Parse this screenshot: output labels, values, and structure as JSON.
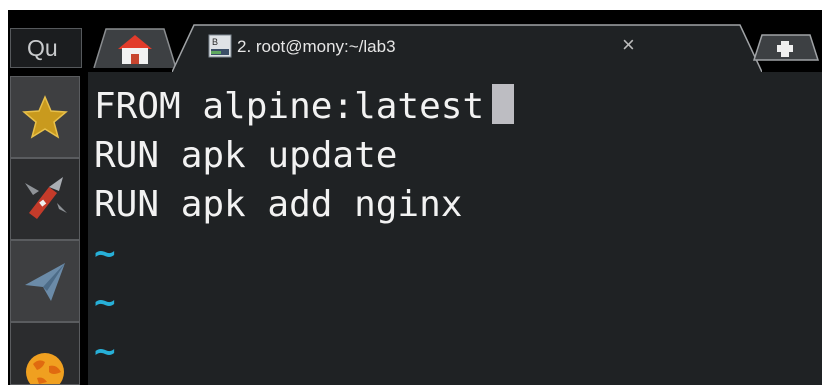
{
  "window": {
    "tab_title": "2. root@mony:~/lab3",
    "close_glyph": "×"
  },
  "search": {
    "partial_text": "Qu"
  },
  "dock": {
    "items": [
      {
        "name": "star-icon"
      },
      {
        "name": "swiss-knife-icon"
      },
      {
        "name": "paper-plane-icon"
      },
      {
        "name": "globe-icon"
      }
    ]
  },
  "terminal": {
    "lines": [
      "FROM alpine:latest",
      "RUN apk update",
      "RUN apk add nginx"
    ],
    "empty_markers": [
      "~",
      "~",
      "~"
    ]
  },
  "colors": {
    "terminal_bg": "#1f2224",
    "text": "#f2f2f2",
    "tilde": "#27b0d8",
    "cursor": "#bdbdc2"
  }
}
